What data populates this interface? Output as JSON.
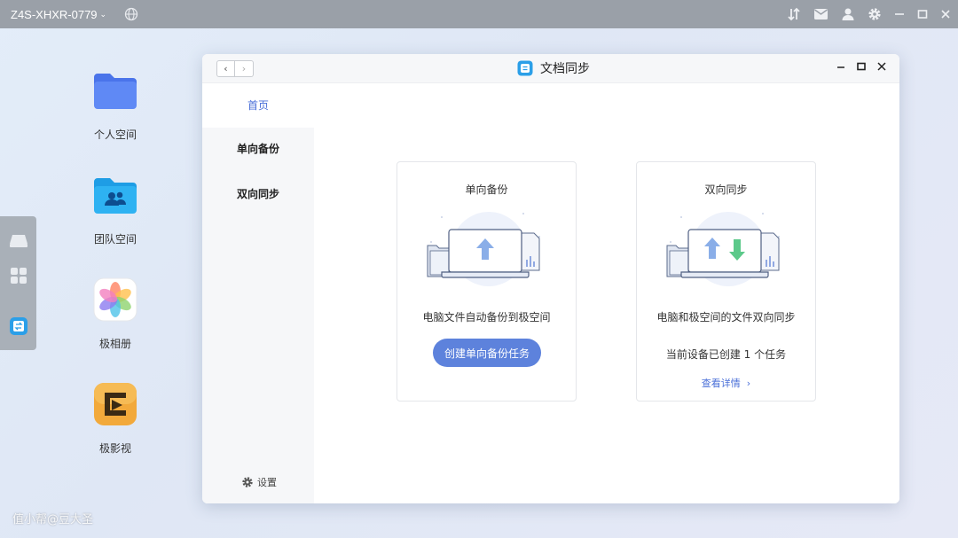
{
  "topbar": {
    "device_name": "Z4S-XHXR-0779",
    "icons": [
      "transfer-icon",
      "mail-icon",
      "user-icon",
      "settings-icon",
      "minimize-icon",
      "maximize-icon",
      "close-icon"
    ]
  },
  "desktop": {
    "items": [
      {
        "label": "个人空间",
        "icon": "folder-icon"
      },
      {
        "label": "团队空间",
        "icon": "team-folder-icon"
      },
      {
        "label": "极相册",
        "icon": "photos-icon"
      },
      {
        "label": "极影视",
        "icon": "video-icon"
      }
    ]
  },
  "window": {
    "title": "文档同步",
    "sidebar": {
      "items": [
        {
          "label": "首页",
          "active": true
        },
        {
          "label": "单向备份",
          "active": false
        },
        {
          "label": "双向同步",
          "active": false
        }
      ],
      "settings_label": "设置"
    },
    "cards": [
      {
        "title": "单向备份",
        "description": "电脑文件自动备份到极空间",
        "button_label": "创建单向备份任务"
      },
      {
        "title": "双向同步",
        "description": "电脑和极空间的文件双向同步",
        "status": "当前设备已创建 1 个任务",
        "link_label": "查看详情"
      }
    ]
  },
  "colors": {
    "accent": "#5d82dc",
    "link": "#4a6fd8",
    "topbar": "#9aa0a8"
  },
  "watermark": "值小帮@豆大圣"
}
